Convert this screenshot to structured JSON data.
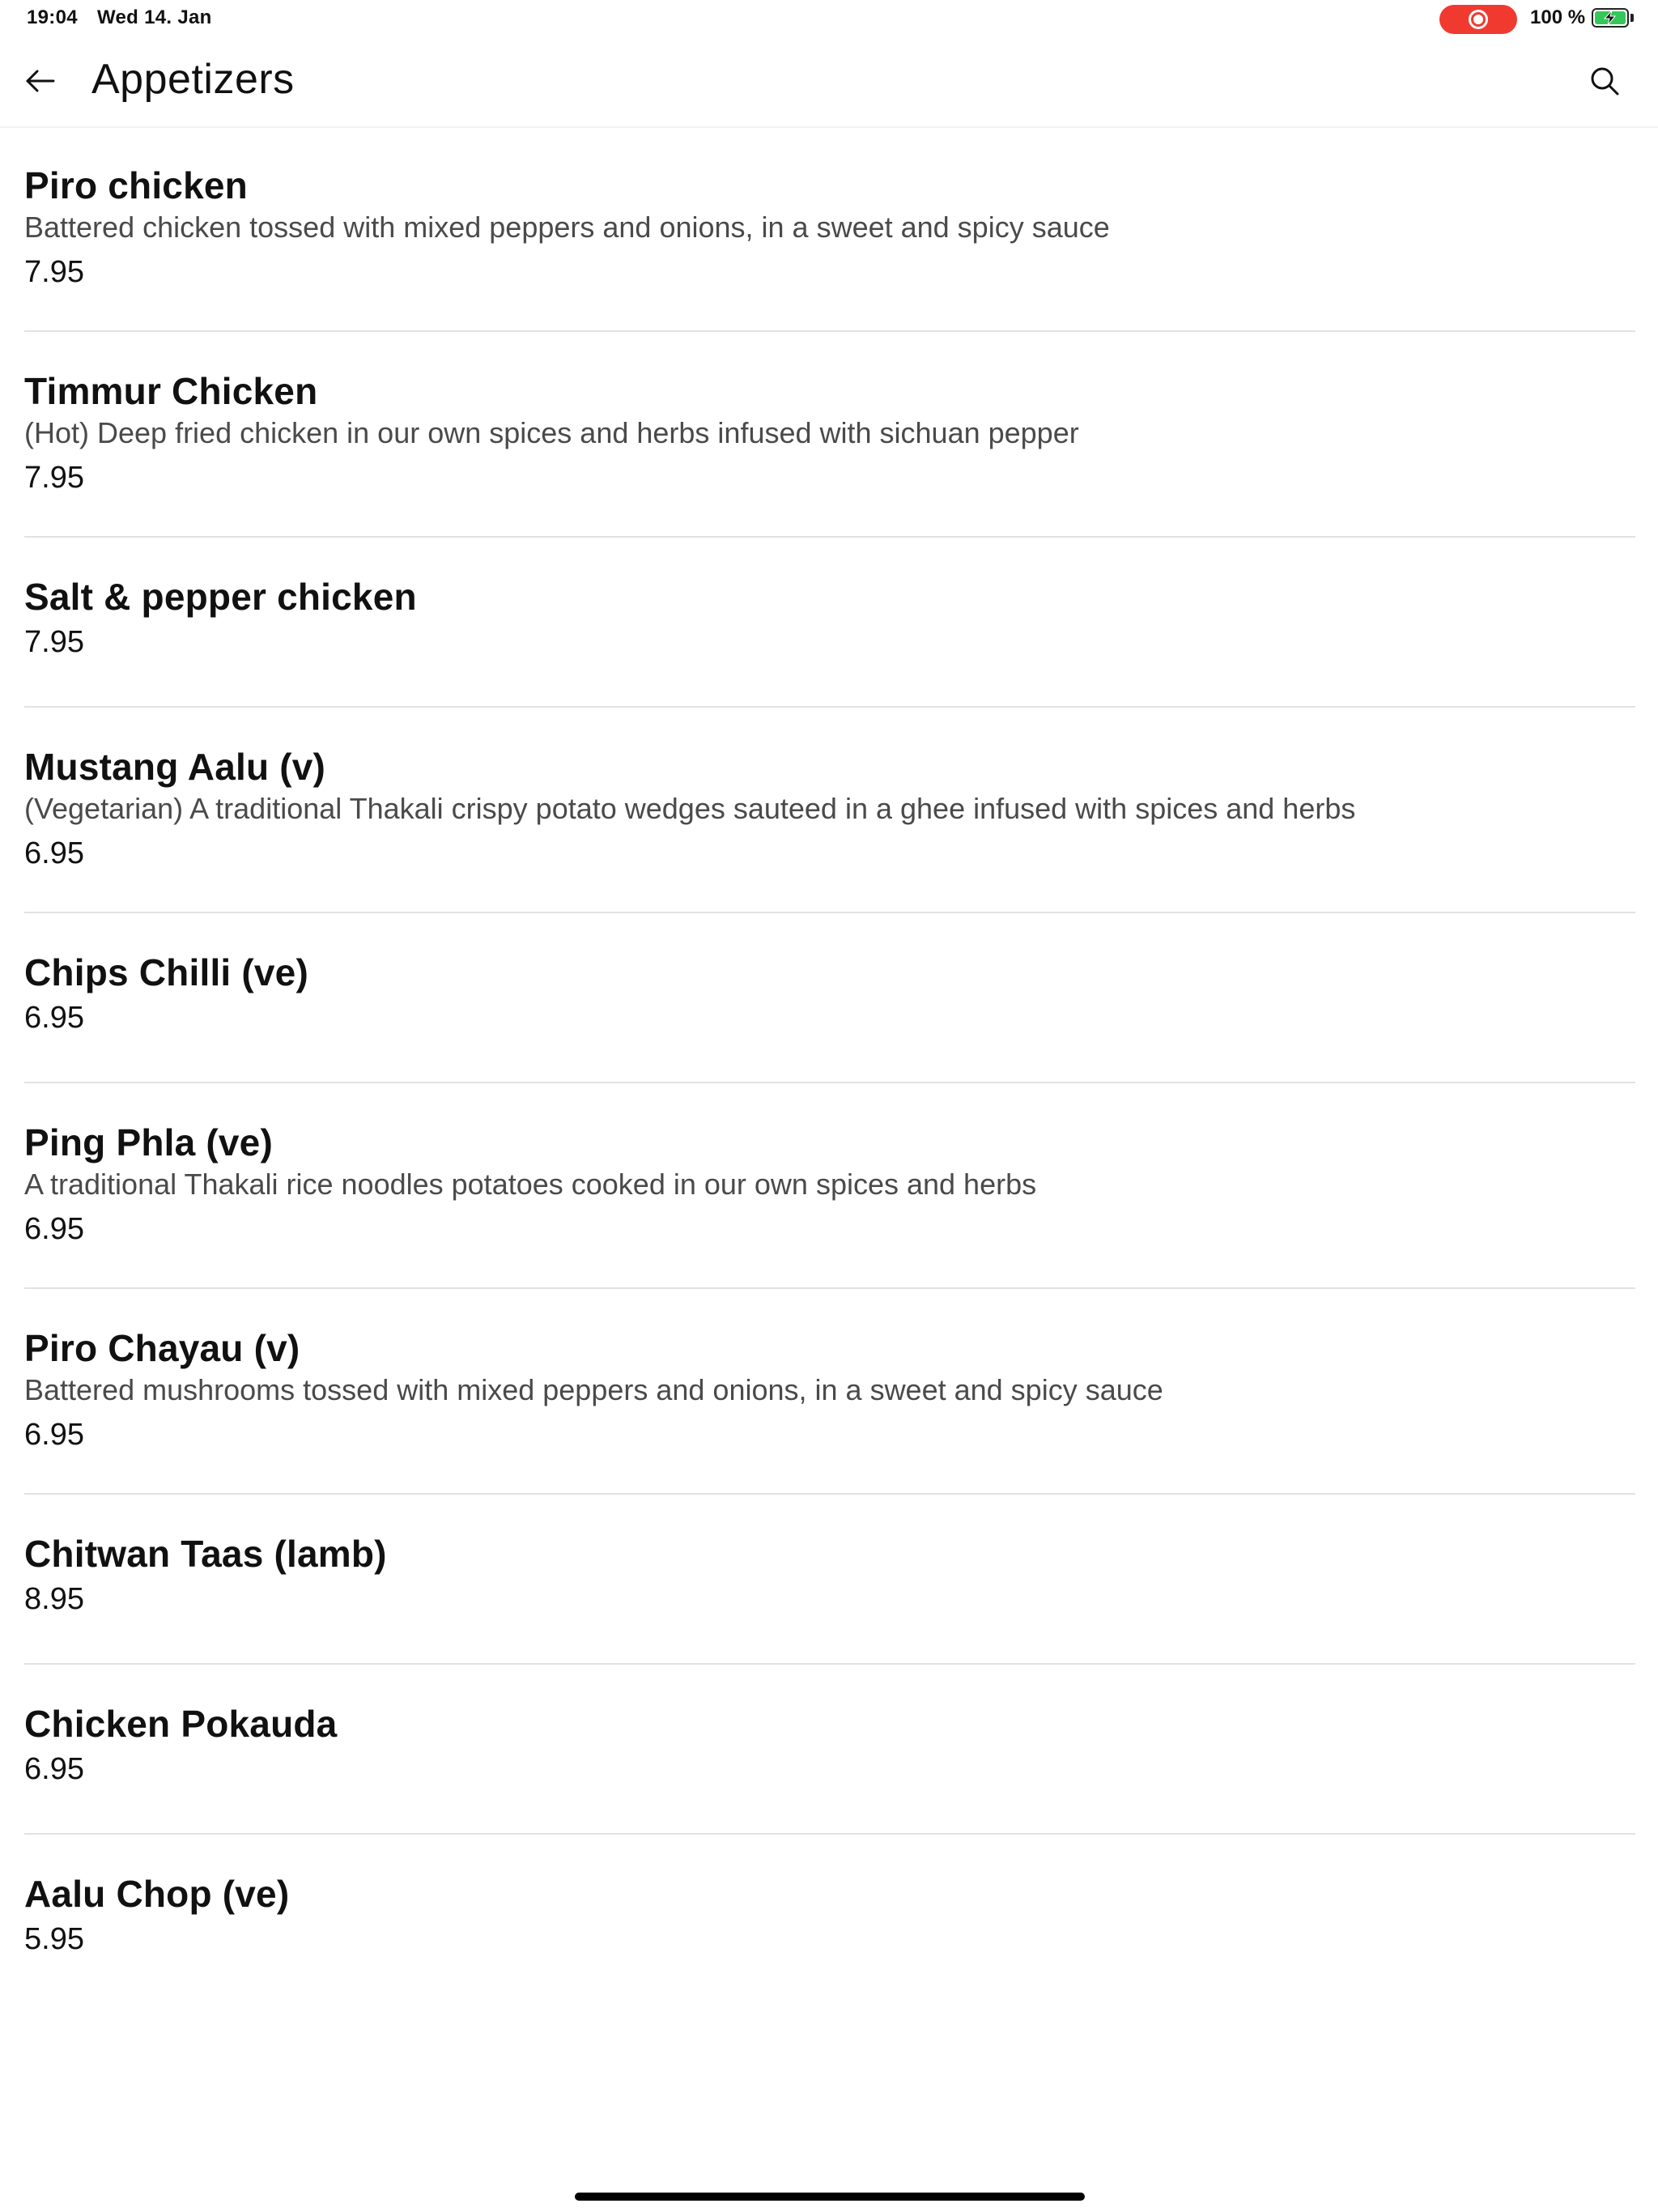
{
  "status_bar": {
    "time": "19:04",
    "date": "Wed 14. Jan",
    "battery": "100 %",
    "record_color": "#f03a2f",
    "battery_color": "#34c759"
  },
  "header": {
    "title": "Appetizers",
    "back_icon": "arrow-left-icon",
    "search_icon": "search-icon"
  },
  "menu": {
    "items": [
      {
        "name": "Piro chicken",
        "description": "Battered chicken tossed with mixed peppers and onions, in a sweet and spicy sauce",
        "price": "7.95"
      },
      {
        "name": "Timmur Chicken",
        "description": "(Hot) Deep fried chicken in our own spices and herbs infused with sichuan pepper",
        "price": "7.95"
      },
      {
        "name": "Salt & pepper chicken",
        "description": "",
        "price": "7.95"
      },
      {
        "name": "Mustang Aalu (v)",
        "description": "(Vegetarian) A traditional Thakali crispy potato wedges sauteed in a ghee infused with spices and herbs",
        "price": "6.95"
      },
      {
        "name": "Chips Chilli (ve)",
        "description": "",
        "price": "6.95"
      },
      {
        "name": "Ping Phla (ve)",
        "description": "A traditional Thakali rice noodles potatoes cooked in our own spices and herbs",
        "price": "6.95"
      },
      {
        "name": "Piro Chayau (v)",
        "description": "Battered mushrooms tossed with mixed peppers and onions, in a sweet and spicy sauce",
        "price": "6.95"
      },
      {
        "name": "Chitwan Taas (lamb)",
        "description": "",
        "price": "8.95"
      },
      {
        "name": "Chicken Pokauda",
        "description": "",
        "price": "6.95"
      },
      {
        "name": "Aalu Chop (ve)",
        "description": "",
        "price": "5.95"
      }
    ]
  }
}
